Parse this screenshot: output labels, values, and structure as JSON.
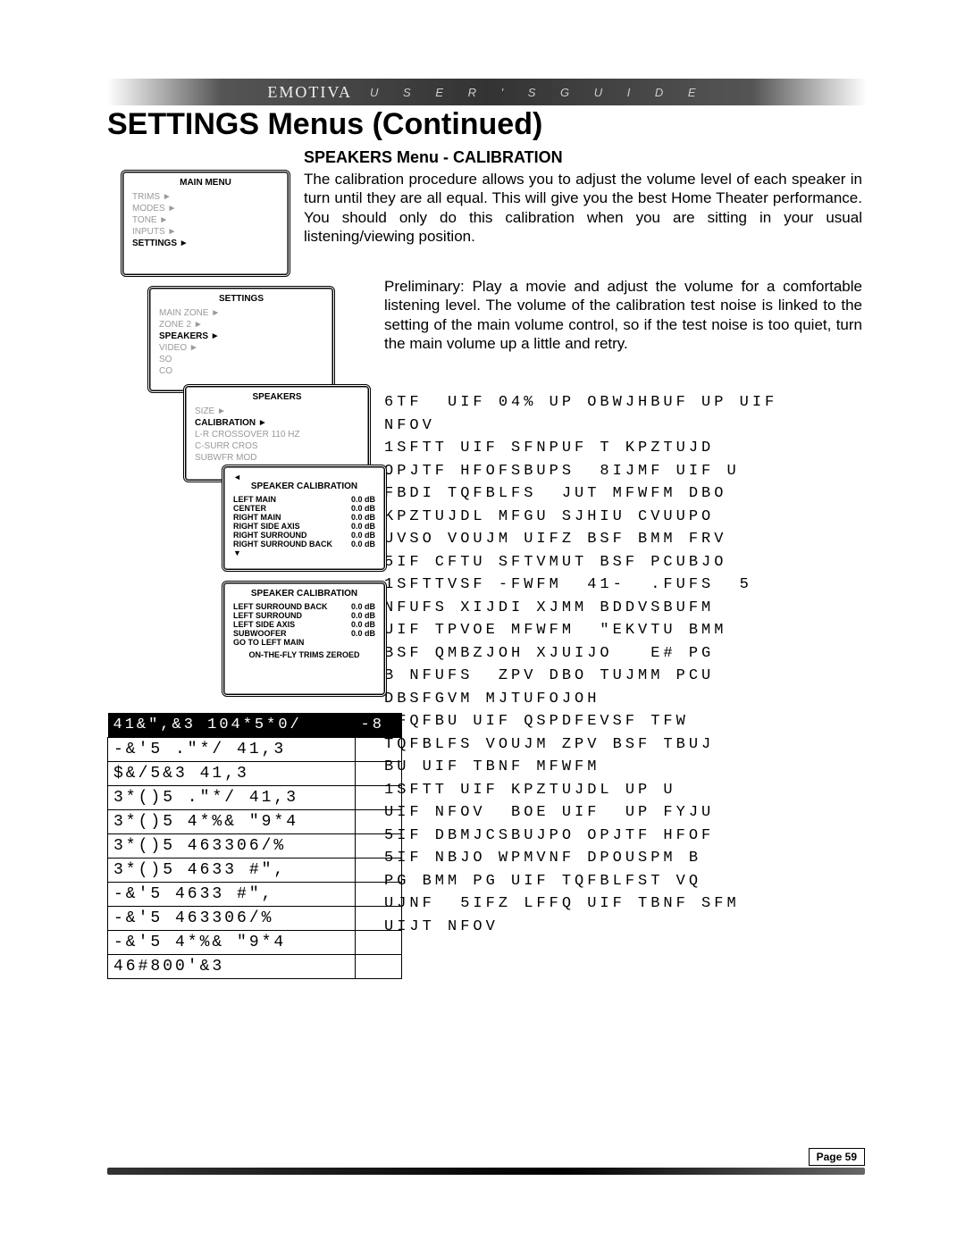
{
  "header": {
    "logo_text": "EMOTIVA",
    "tagline": "U S E R ' S   G U I D E"
  },
  "title": "SETTINGS Menus (Continued)",
  "section_title": "SPEAKERS Menu - CALIBRATION",
  "body1": "The calibration procedure allows you to adjust the volume level of each speaker in turn until they are all equal. This will give you the best Home Theater performance. You should only do this calibration when you are sitting in your usual listening/viewing position.",
  "body2": "Preliminary: Play a movie and adjust the volume for a comfortable listening level. The volume of the calibration test noise is linked to the setting of the main volume control, so if the test noise is too quiet, turn the main volume up a little and retry.",
  "body3_lines": [
    "6TF  UIF 04% UP OBWJHBUF UP UIF",
    "NFOV",
    "1SFTT UIF SFNPUF T KPZTUJD",
    "OPJTF HFOFSBUPS  8IJMF UIF U",
    "FBDI TQFBLFS  JUT MFWFM DBO",
    "KPZTUJDL MFGU SJHIU CVUUPO",
    "UVSO VOUJM UIFZ BSF BMM FRV",
    "5IF CFTU SFTVMUT BSF PCUBJO",
    "1SFTTVSF -FWFM  41-  .FUFS  5",
    "NFUFS XIJDI XJMM BDDVSBUFM",
    "UIF TPVOE MFWFM  \"EKVTU BMM",
    "BSF QMBZJOH XJUIJO   E# PG",
    "B NFUFS  ZPV DBO TUJMM PCU",
    "DBSFGVM MJTUFOJOH",
    "3FQFBU UIF QSPDFEVSF TFW",
    "TQFBLFS VOUJM ZPV BSF TBUJ",
    "BU UIF TBNF MFWFM",
    "1SFTT UIF KPZTUJDL UP U",
    "UIF NFOV  BOE UIF  UP FYJU",
    "5IF DBMJCSBUJPO OPJTF HFOF",
    "5IF NBJO WPMVNF DPOUSPM B",
    "PG BMM PG UIF TQFBLFST VQ",
    "UJNF  5IFZ LFFQ UIF TBNF SFM",
    "UIJT NFOV"
  ],
  "osd_main": {
    "title": "MAIN MENU",
    "items": [
      "TRIMS ►",
      "MODES ►",
      "TONE ►",
      "INPUTS ►",
      "SETTINGS ►"
    ],
    "selected": 4
  },
  "osd_settings": {
    "title": "SETTINGS",
    "items": [
      "MAIN ZONE ►",
      "ZONE 2 ►",
      "SPEAKERS ►",
      "VIDEO ►",
      "SO",
      "CO"
    ],
    "selected": 2
  },
  "osd_speakers": {
    "title": "SPEAKERS",
    "items": [
      "SIZE ►",
      "CALIBRATION ►",
      "L-R CROSSOVER        110 HZ",
      "C-SURR CROS",
      "SUBWFR MOD"
    ],
    "selected": 1
  },
  "osd_cal1": {
    "title": "SPEAKER CALIBRATION",
    "rows": [
      [
        "LEFT MAIN",
        "0.0 dB"
      ],
      [
        "CENTER",
        "0.0 dB"
      ],
      [
        "RIGHT MAIN",
        "0.0 dB"
      ],
      [
        "RIGHT SIDE AXIS",
        "0.0 dB"
      ],
      [
        "RIGHT SURROUND",
        "0.0 dB"
      ],
      [
        "RIGHT SURROUND BACK",
        "0.0 dB"
      ]
    ]
  },
  "osd_cal2": {
    "title": "SPEAKER CALIBRATION",
    "rows": [
      [
        "LEFT SURROUND BACK",
        "0.0 dB"
      ],
      [
        "LEFT SURROUND",
        "0.0 dB"
      ],
      [
        "LEFT SIDE AXIS",
        "0.0 dB"
      ],
      [
        "SUBWOOFER",
        "0.0 dB"
      ],
      [
        "GO TO LEFT MAIN",
        ""
      ]
    ],
    "footer": "ON-THE-FLY TRIMS ZEROED"
  },
  "table": {
    "header": [
      "41&\",&3 104*5*0/",
      "-8"
    ],
    "rows": [
      "-&'5 .\"*/ 41,3",
      "$&/5&3 41,3",
      "3*()5 .\"*/ 41,3",
      "3*()5 4*%& \"9*4",
      "3*()5 463306/%",
      "3*()5 4633 #\",",
      "-&'5 4633 #\",",
      "-&'5 463306/%",
      "-&'5 4*%& \"9*4",
      "46#800'&3"
    ]
  },
  "footer": {
    "page": "Page 59"
  }
}
